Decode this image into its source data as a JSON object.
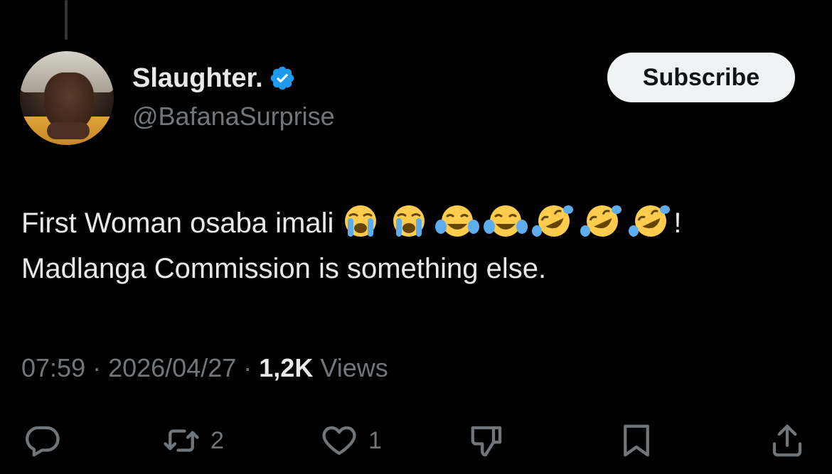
{
  "tweet": {
    "author": {
      "display_name": "Slaughter.",
      "handle": "@BafanaSurprise",
      "verified": true
    },
    "subscribe_label": "Subscribe",
    "text_line1": "First Woman osaba imali",
    "text_line1_end": "!",
    "text_line2": "Madlanga Commission is something else.",
    "emojis": [
      "crying-face",
      "crying-face",
      "tears-of-joy",
      "tears-of-joy",
      "rofl",
      "rofl",
      "rofl"
    ],
    "time": "07:59",
    "date": "2026/04/27",
    "separator": " · ",
    "views_count": "1,2K",
    "views_label": "Views"
  },
  "actions": {
    "reply_icon": "reply-icon",
    "retweet_icon": "retweet-icon",
    "retweet_count": "2",
    "like_icon": "heart-icon",
    "like_count": "1",
    "dislike_icon": "thumbs-down-icon",
    "bookmark_icon": "bookmark-icon",
    "share_icon": "share-icon"
  },
  "colors": {
    "background": "#000000",
    "text_primary": "#e7e9ea",
    "text_secondary": "#71767b",
    "verified_blue": "#1d9bf0",
    "button_bg": "#eff3f4"
  }
}
